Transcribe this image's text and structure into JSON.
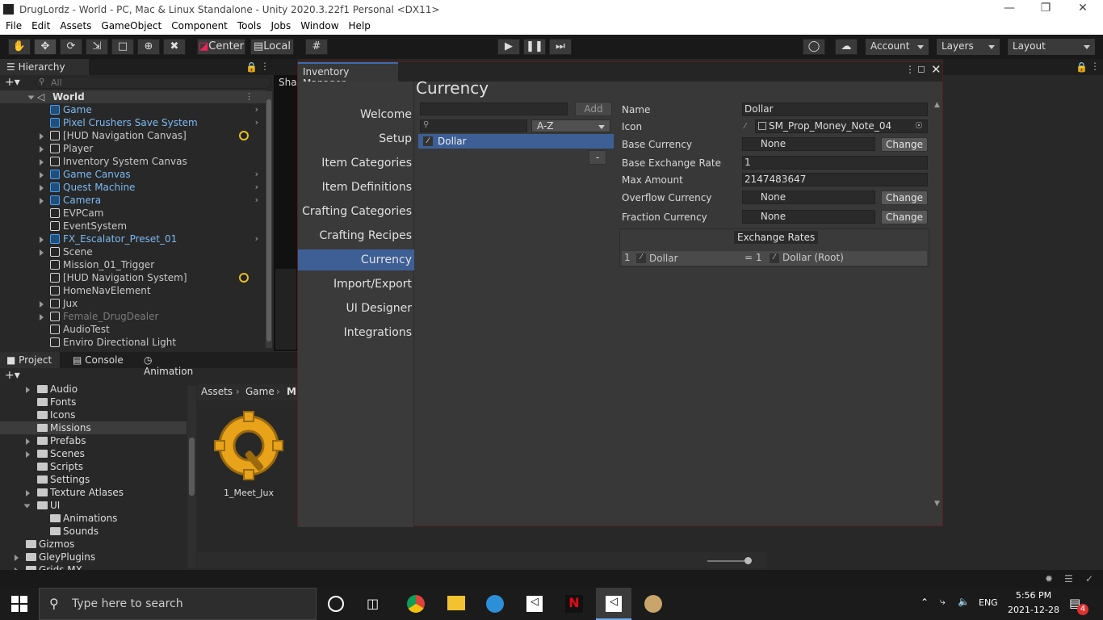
{
  "window": {
    "title": "DrugLordz - World - PC, Mac & Linux Standalone - Unity 2020.3.22f1 Personal <DX11>"
  },
  "menu": [
    "File",
    "Edit",
    "Assets",
    "GameObject",
    "Component",
    "Tools",
    "Jobs",
    "Window",
    "Help"
  ],
  "toolbar": {
    "center_label": "Center",
    "local_label": "Local",
    "account_label": "Account",
    "layers_label": "Layers",
    "layout_label": "Layout"
  },
  "hierarchy": {
    "tab": "Hierarchy",
    "search_placeholder": "All",
    "scene": "World",
    "items": [
      {
        "label": "Game",
        "blue": true,
        "arrow": true
      },
      {
        "label": "Pixel Crushers Save System",
        "blue": true,
        "arrow": true
      },
      {
        "label": "[HUD Navigation Canvas]",
        "fold": true,
        "badge": true
      },
      {
        "label": "Player",
        "fold": true
      },
      {
        "label": "Inventory System Canvas",
        "fold": true
      },
      {
        "label": "Game Canvas",
        "blue": true,
        "fold": true,
        "arrow": true
      },
      {
        "label": "Quest Machine",
        "blue": true,
        "fold": true,
        "arrow": true
      },
      {
        "label": "Camera",
        "blue": true,
        "fold": true,
        "arrow": true
      },
      {
        "label": "EVPCam"
      },
      {
        "label": "EventSystem"
      },
      {
        "label": "FX_Escalator_Preset_01",
        "blue": true,
        "fold": true,
        "arrow": true
      },
      {
        "label": "Scene",
        "fold": true
      },
      {
        "label": "Mission_01_Trigger"
      },
      {
        "label": "[HUD Navigation System]",
        "badge": true
      },
      {
        "label": "HomeNavElement"
      },
      {
        "label": "Jux",
        "fold": true
      },
      {
        "label": "Female_DrugDealer",
        "gray": true,
        "fold": true
      },
      {
        "label": "AudioTest"
      },
      {
        "label": "Enviro Directional Light"
      }
    ]
  },
  "scene_tab": "Sha",
  "project": {
    "tabs": [
      "Project",
      "Console",
      "Animation"
    ],
    "folders": [
      {
        "label": "Audio",
        "fold": true,
        "level": 1
      },
      {
        "label": "Fonts",
        "level": 1
      },
      {
        "label": "Icons",
        "level": 1
      },
      {
        "label": "Missions",
        "level": 1,
        "selected": true
      },
      {
        "label": "Prefabs",
        "fold": true,
        "level": 1
      },
      {
        "label": "Scenes",
        "fold": true,
        "level": 1
      },
      {
        "label": "Scripts",
        "level": 1
      },
      {
        "label": "Settings",
        "level": 1
      },
      {
        "label": "Texture Atlases",
        "fold": true,
        "level": 1
      },
      {
        "label": "UI",
        "open": true,
        "level": 1
      },
      {
        "label": "Animations",
        "level": 2
      },
      {
        "label": "Sounds",
        "level": 2
      },
      {
        "label": "Gizmos",
        "level": 0
      },
      {
        "label": "GleyPlugins",
        "fold": true,
        "level": 0
      },
      {
        "label": "Grids MX",
        "fold": true,
        "level": 0
      }
    ],
    "breadcrumb": [
      "Assets",
      "Game",
      "M"
    ],
    "asset_label": "1_Meet_Jux"
  },
  "inventory": {
    "title": "Inventory Manager",
    "heading": "Currency",
    "nav": [
      "Welcome",
      "Setup",
      "Item Categories",
      "Item Definitions",
      "Crafting Categories",
      "Crafting Recipes",
      "Currency",
      "Import/Export",
      "UI Designer",
      "Integrations"
    ],
    "active_nav": "Currency",
    "add_label": "Add",
    "sort": "A-Z",
    "list": [
      "Dollar"
    ],
    "remove_label": "-",
    "fields": {
      "name_label": "Name",
      "name": "Dollar",
      "icon_label": "Icon",
      "icon": "SM_Prop_Money_Note_04",
      "base_label": "Base Currency",
      "base": "None",
      "rate_label": "Base Exchange Rate",
      "rate": "1",
      "max_label": "Max Amount",
      "max": "2147483647",
      "overflow_label": "Overflow Currency",
      "overflow": "None",
      "fraction_label": "Fraction Currency",
      "fraction": "None",
      "change_label": "Change"
    },
    "exchange": {
      "header": "Exchange Rates",
      "index": "1",
      "from": "Dollar",
      "eq": "= 1",
      "to": "Dollar (Root)"
    }
  },
  "taskbar": {
    "search_placeholder": "Type here to search",
    "lang": "ENG",
    "time": "5:56 PM",
    "date": "2021-12-28",
    "notif": "4"
  }
}
